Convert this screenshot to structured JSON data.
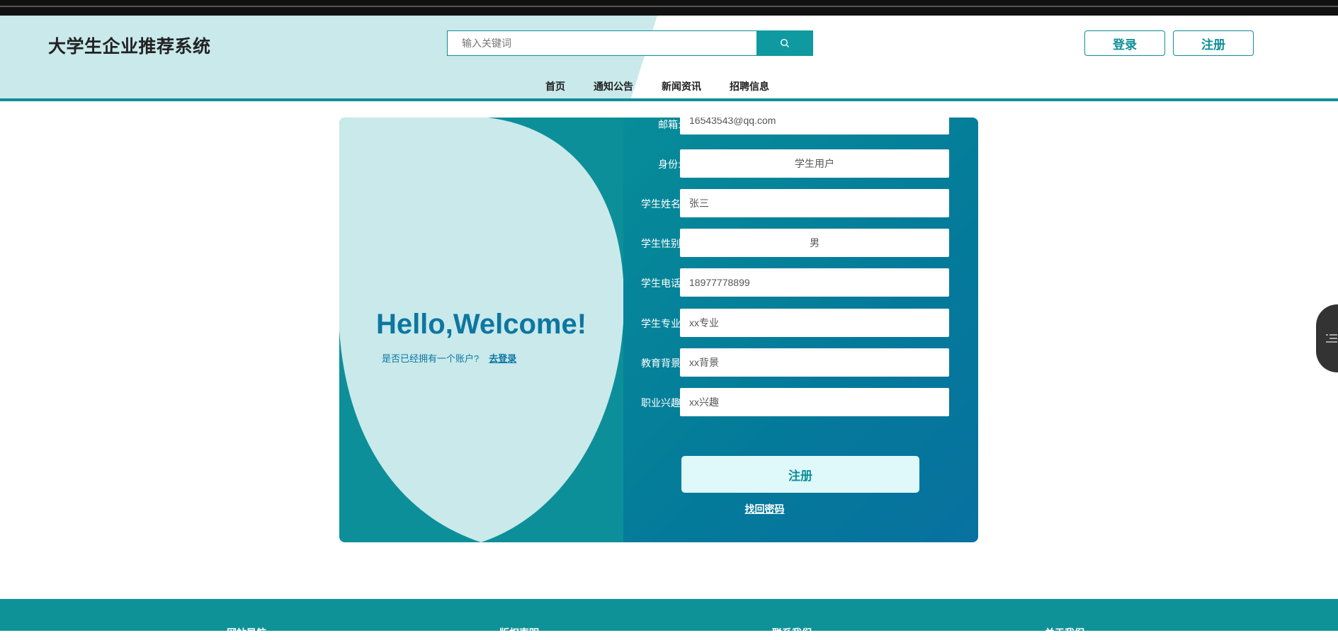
{
  "header": {
    "site_title": "大学生企业推荐系统",
    "search": {
      "placeholder": "输入关键词"
    },
    "login_label": "登录",
    "register_label": "注册",
    "nav": [
      "首页",
      "通知公告",
      "新闻资讯",
      "招聘信息"
    ]
  },
  "welcome": {
    "title": "Hello,Welcome!",
    "question": "是否已经拥有一个账户?",
    "login_link": "去登录"
  },
  "form": {
    "rows": [
      {
        "label": "邮箱:",
        "value": "16543543@qq.com"
      },
      {
        "label": "身份:",
        "value": "学生用户"
      },
      {
        "label": "学生姓名",
        "value": "张三"
      },
      {
        "label": "学生性别",
        "value": "男"
      },
      {
        "label": "学生电话",
        "value": "18977778899"
      },
      {
        "label": "学生专业",
        "value": "xx专业"
      },
      {
        "label": "教育背景",
        "value": "xx背景"
      },
      {
        "label": "职业兴趣",
        "value": "xx兴趣"
      }
    ],
    "submit_label": "注册",
    "forgot_label": "找回密码"
  },
  "footer": [
    "网站导航",
    "版权声明",
    "联系我们",
    "关于我们"
  ],
  "colors": {
    "accent": "#0e8f98",
    "light": "#c9e9eb"
  }
}
